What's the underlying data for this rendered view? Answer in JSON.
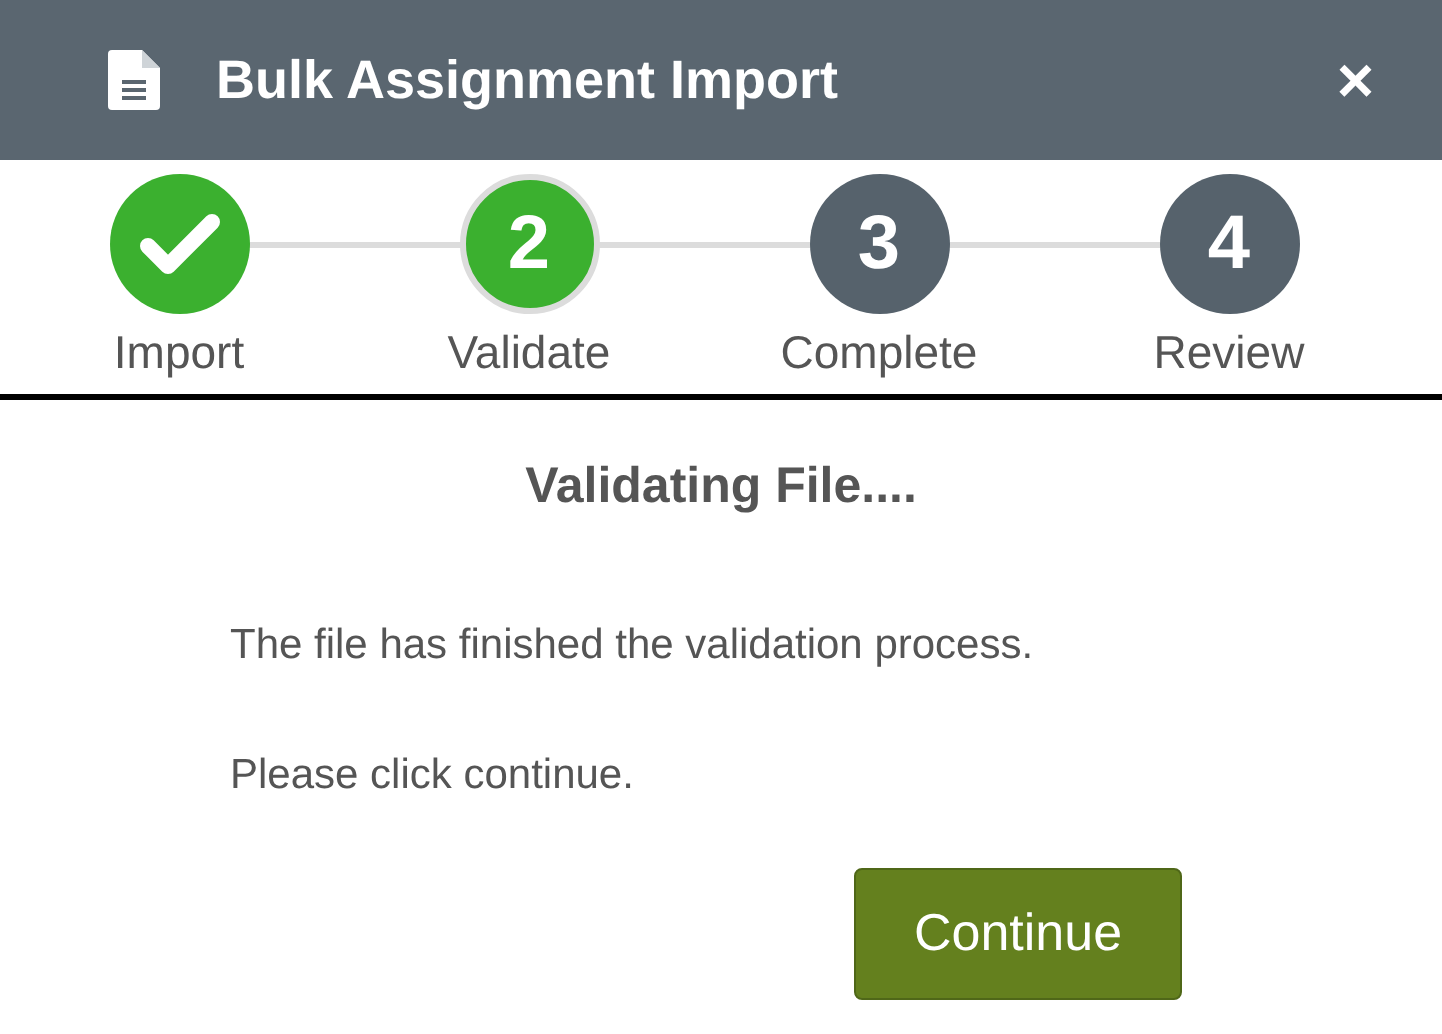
{
  "dialog": {
    "title": "Bulk Assignment Import",
    "close": "×"
  },
  "steps": [
    {
      "label": "Import",
      "completed": true,
      "selected": false
    },
    {
      "number": "2",
      "label": "Validate",
      "completed": false,
      "selected": true
    },
    {
      "number": "3",
      "label": "Complete",
      "completed": false,
      "selected": false
    },
    {
      "number": "4",
      "label": "Review",
      "completed": false,
      "selected": false
    }
  ],
  "heading": "Validating File....",
  "messages": [
    "The file has finished the validation process.",
    "Please click continue."
  ],
  "button": "Continue"
}
